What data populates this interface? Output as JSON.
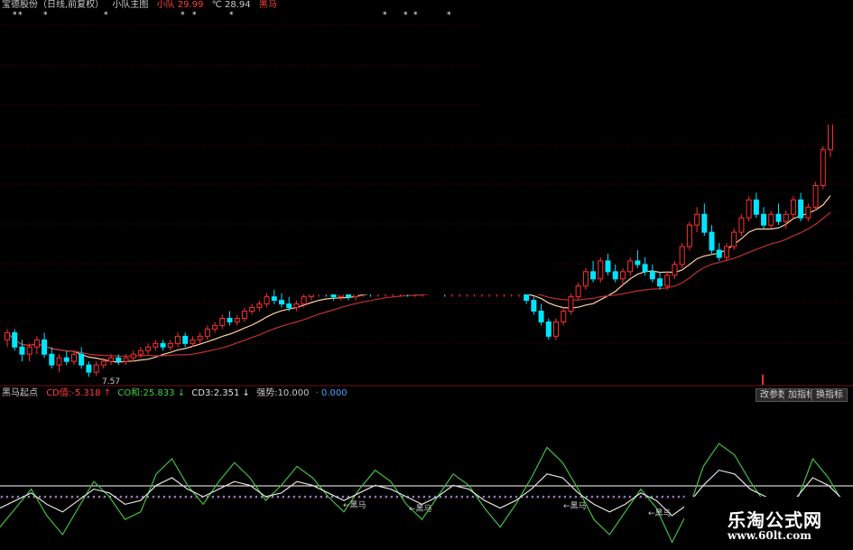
{
  "header": {
    "stock_title": "宝德股份（日线,前复权）",
    "indicator_label": "小队主图",
    "signal_label": "小队",
    "signal_value": "29.99",
    "level_label": "℃",
    "level_value": "28.94",
    "black_horse_label": "黑马"
  },
  "indicator_bar": {
    "name": "黑马起点",
    "cd_label": "CD值:",
    "cd_value": "-5.318",
    "cd_arrow": "↑",
    "co_label": "CO和:",
    "co_value": "25.833",
    "co_arrow": "↓",
    "cd3_label": "CD3:",
    "cd3_value": "2.351",
    "cd3_arrow": "↓",
    "strength_label": "强势:",
    "strength_value": "10.000",
    "extra_label": "",
    "extra_value": "0.000",
    "buttons": [
      "改参数",
      "加指标",
      "换指标"
    ]
  },
  "annotations": {
    "low_price": "7.57",
    "heima_marks": [
      "←黑马",
      "←黑马",
      "←黑马",
      "←黑马"
    ]
  },
  "watermark": {
    "line1": "乐淘公式网",
    "line2": "www.60lt.com"
  },
  "colors": {
    "up": "#ff3030",
    "down": "#00e5ff",
    "ma_fast": "#ffd0a0",
    "ma_slow": "#c03030",
    "osc_green": "#40c040",
    "osc_white": "#e0e0e0",
    "osc_red": "#ff3030",
    "dot_line": "#4aa0ff"
  },
  "chart_data": [
    {
      "type": "candlestick",
      "title": "宝德股份（日线,前复权）",
      "candles": [
        [
          8.6,
          8.9,
          8.4,
          8.8
        ],
        [
          8.8,
          8.9,
          8.3,
          8.4
        ],
        [
          8.4,
          8.6,
          8.0,
          8.2
        ],
        [
          8.2,
          8.5,
          8.0,
          8.4
        ],
        [
          8.4,
          8.7,
          8.2,
          8.6
        ],
        [
          8.6,
          8.8,
          8.1,
          8.2
        ],
        [
          8.2,
          8.4,
          7.8,
          7.9
        ],
        [
          7.9,
          8.2,
          7.7,
          8.1
        ],
        [
          8.1,
          8.3,
          7.9,
          8.0
        ],
        [
          8.0,
          8.3,
          7.9,
          8.2
        ],
        [
          8.2,
          8.4,
          7.8,
          7.9
        ],
        [
          7.9,
          8.0,
          7.57,
          7.7
        ],
        [
          7.7,
          8.0,
          7.6,
          7.9
        ],
        [
          7.9,
          8.1,
          7.8,
          8.0
        ],
        [
          8.0,
          8.2,
          7.9,
          8.1
        ],
        [
          8.1,
          8.2,
          7.9,
          8.0
        ],
        [
          8.0,
          8.2,
          7.9,
          8.1
        ],
        [
          8.1,
          8.3,
          8.0,
          8.2
        ],
        [
          8.2,
          8.4,
          8.1,
          8.3
        ],
        [
          8.3,
          8.5,
          8.2,
          8.4
        ],
        [
          8.4,
          8.6,
          8.3,
          8.5
        ],
        [
          8.5,
          8.6,
          8.3,
          8.4
        ],
        [
          8.4,
          8.6,
          8.3,
          8.5
        ],
        [
          8.5,
          8.8,
          8.4,
          8.7
        ],
        [
          8.7,
          8.8,
          8.4,
          8.5
        ],
        [
          8.5,
          8.7,
          8.4,
          8.6
        ],
        [
          8.6,
          8.8,
          8.5,
          8.7
        ],
        [
          8.7,
          9.0,
          8.6,
          8.9
        ],
        [
          8.9,
          9.1,
          8.8,
          9.0
        ],
        [
          9.0,
          9.3,
          8.9,
          9.2
        ],
        [
          9.2,
          9.4,
          9.0,
          9.1
        ],
        [
          9.1,
          9.3,
          9.0,
          9.2
        ],
        [
          9.2,
          9.5,
          9.1,
          9.4
        ],
        [
          9.4,
          9.6,
          9.3,
          9.5
        ],
        [
          9.5,
          9.7,
          9.4,
          9.6
        ],
        [
          9.6,
          9.9,
          9.5,
          9.8
        ],
        [
          9.8,
          10.0,
          9.6,
          9.7
        ],
        [
          9.7,
          9.9,
          9.5,
          9.6
        ],
        [
          9.6,
          9.8,
          9.4,
          9.5
        ],
        [
          9.5,
          9.7,
          9.4,
          9.6
        ],
        [
          9.6,
          9.9,
          9.5,
          9.8
        ],
        [
          9.8,
          10.0,
          9.7,
          9.9
        ],
        [
          9.9,
          10.1,
          9.8,
          10.0
        ],
        [
          10.0,
          10.1,
          9.8,
          9.9
        ],
        [
          9.9,
          10.0,
          9.7,
          9.8
        ],
        [
          9.8,
          10.0,
          9.7,
          9.9
        ],
        [
          9.9,
          10.0,
          9.7,
          9.8
        ],
        [
          9.8,
          10.0,
          9.7,
          9.9
        ],
        [
          9.9,
          10.1,
          9.8,
          10.0
        ],
        [
          10.0,
          10.1,
          9.8,
          9.9
        ],
        [
          9.9,
          10.0,
          9.8,
          9.9
        ],
        [
          9.9,
          10.0,
          9.8,
          9.9
        ],
        [
          9.9,
          10.0,
          9.8,
          9.9
        ],
        [
          9.9,
          10.1,
          9.8,
          10.0
        ],
        [
          10.0,
          10.1,
          9.8,
          9.9
        ],
        [
          9.9,
          10.0,
          9.8,
          9.9
        ],
        [
          9.9,
          10.1,
          9.8,
          10.0
        ],
        [
          10.0,
          10.2,
          9.9,
          10.1
        ],
        [
          10.1,
          10.2,
          9.9,
          10.0
        ],
        [
          10.0,
          10.1,
          9.8,
          9.9
        ],
        [
          9.9,
          10.0,
          9.8,
          9.9
        ],
        [
          9.9,
          10.0,
          9.8,
          9.9
        ],
        [
          9.9,
          10.0,
          9.8,
          9.9
        ],
        [
          9.9,
          10.0,
          9.8,
          9.9
        ],
        [
          9.9,
          10.0,
          9.8,
          9.9
        ],
        [
          9.9,
          10.0,
          9.8,
          9.9
        ],
        [
          9.9,
          10.0,
          9.8,
          9.9
        ],
        [
          9.9,
          10.0,
          9.8,
          9.9
        ],
        [
          9.9,
          10.0,
          9.8,
          9.9
        ],
        [
          9.9,
          10.0,
          9.8,
          9.9
        ],
        [
          10.0,
          10.1,
          9.6,
          9.7
        ],
        [
          9.7,
          9.8,
          9.3,
          9.4
        ],
        [
          9.4,
          9.6,
          9.0,
          9.1
        ],
        [
          9.1,
          9.2,
          8.6,
          8.7
        ],
        [
          8.7,
          9.2,
          8.6,
          9.1
        ],
        [
          9.1,
          9.5,
          9.0,
          9.4
        ],
        [
          9.4,
          9.9,
          9.3,
          9.8
        ],
        [
          9.8,
          10.2,
          9.7,
          10.1
        ],
        [
          10.1,
          10.6,
          10.0,
          10.5
        ],
        [
          10.5,
          10.8,
          10.2,
          10.3
        ],
        [
          10.3,
          10.9,
          10.2,
          10.8
        ],
        [
          10.8,
          11.0,
          10.4,
          10.5
        ],
        [
          10.5,
          10.7,
          10.2,
          10.3
        ],
        [
          10.3,
          10.6,
          10.1,
          10.5
        ],
        [
          10.5,
          10.9,
          10.4,
          10.8
        ],
        [
          10.8,
          11.1,
          10.6,
          10.7
        ],
        [
          10.7,
          10.9,
          10.4,
          10.5
        ],
        [
          10.5,
          10.7,
          10.2,
          10.3
        ],
        [
          10.3,
          10.5,
          10.0,
          10.1
        ],
        [
          10.1,
          10.5,
          10.0,
          10.4
        ],
        [
          10.4,
          10.8,
          10.3,
          10.7
        ],
        [
          10.7,
          11.3,
          10.6,
          11.2
        ],
        [
          11.2,
          11.9,
          11.1,
          11.8
        ],
        [
          11.8,
          12.3,
          11.6,
          12.1
        ],
        [
          12.1,
          12.4,
          11.5,
          11.6
        ],
        [
          11.6,
          11.8,
          11.0,
          11.1
        ],
        [
          11.1,
          11.3,
          10.8,
          10.9
        ],
        [
          10.9,
          11.3,
          10.8,
          11.2
        ],
        [
          11.2,
          11.7,
          11.1,
          11.6
        ],
        [
          11.6,
          12.1,
          11.5,
          12.0
        ],
        [
          12.0,
          12.6,
          11.9,
          12.5
        ],
        [
          12.5,
          12.7,
          12.0,
          12.1
        ],
        [
          12.1,
          12.3,
          11.7,
          11.8
        ],
        [
          11.8,
          12.2,
          11.7,
          12.1
        ],
        [
          12.1,
          12.4,
          11.8,
          11.9
        ],
        [
          11.9,
          12.2,
          11.7,
          12.1
        ],
        [
          12.1,
          12.6,
          12.0,
          12.5
        ],
        [
          12.5,
          12.7,
          11.9,
          12.0
        ],
        [
          12.0,
          12.4,
          11.9,
          12.3
        ],
        [
          12.3,
          13.0,
          12.2,
          12.9
        ],
        [
          12.9,
          14.0,
          12.8,
          13.9
        ],
        [
          13.9,
          14.8,
          13.7,
          14.7
        ]
      ],
      "annotations": [
        "7.57"
      ]
    },
    {
      "type": "line",
      "title": "黑马起点",
      "series": [
        {
          "name": "CO和",
          "values": [
            -8,
            -3,
            2,
            -5,
            -10,
            -3,
            4,
            0,
            -6,
            -4,
            6,
            10,
            3,
            -2,
            4,
            9,
            5,
            -1,
            3,
            8,
            5,
            0,
            -4,
            2,
            7,
            4,
            -2,
            -6,
            0,
            6,
            3,
            -3,
            -8,
            -2,
            5,
            13,
            9,
            2,
            -6,
            -10,
            -4,
            2,
            -3,
            -12,
            -4,
            8,
            14,
            11,
            4,
            -2,
            -6,
            -1,
            10,
            5,
            -2
          ]
        },
        {
          "name": "CD3",
          "values": [
            -3,
            -1,
            1,
            -2,
            -4,
            -1,
            2,
            1,
            -2,
            -1,
            3,
            5,
            2,
            0,
            2,
            4,
            3,
            0,
            1,
            4,
            3,
            1,
            -1,
            1,
            3,
            2,
            0,
            -2,
            0,
            3,
            2,
            -1,
            -3,
            -1,
            2,
            6,
            5,
            1,
            -2,
            -4,
            -2,
            1,
            -1,
            -5,
            -2,
            3,
            7,
            6,
            2,
            0,
            -2,
            0,
            5,
            3,
            -1
          ]
        }
      ]
    }
  ]
}
